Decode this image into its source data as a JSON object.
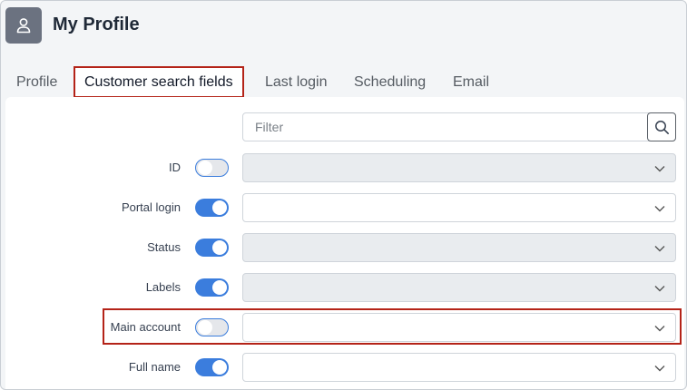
{
  "header": {
    "title": "My Profile",
    "icon": "user-icon"
  },
  "tabs": [
    {
      "label": "Profile",
      "active": false
    },
    {
      "label": "Customer search fields",
      "active": true
    },
    {
      "label": "Last login",
      "active": false
    },
    {
      "label": "Scheduling",
      "active": false
    },
    {
      "label": "Email",
      "active": false
    }
  ],
  "filter": {
    "placeholder": "Filter",
    "value": "",
    "icon": "search-icon"
  },
  "fields": [
    {
      "label": "ID",
      "toggle": "off",
      "select": "disabled",
      "selected": ""
    },
    {
      "label": "Portal login",
      "toggle": "on",
      "select": "enabled",
      "selected": ""
    },
    {
      "label": "Status",
      "toggle": "on",
      "select": "disabled",
      "selected": ""
    },
    {
      "label": "Labels",
      "toggle": "on",
      "select": "disabled",
      "selected": ""
    },
    {
      "label": "Main account",
      "toggle": "off",
      "select": "enabled",
      "selected": ""
    },
    {
      "label": "Full name",
      "toggle": "on",
      "select": "enabled",
      "selected": ""
    }
  ],
  "colors": {
    "accent": "#3b7ddd",
    "highlight": "#b42318",
    "badge": "#6b7280"
  }
}
